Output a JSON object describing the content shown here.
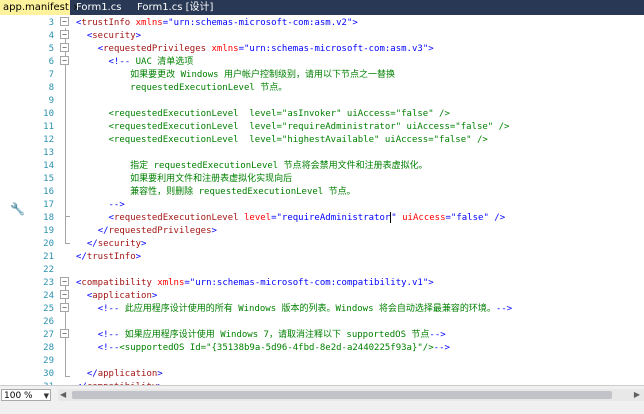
{
  "tabs": [
    {
      "label": "app.manifest",
      "active": true,
      "close": "×"
    },
    {
      "label": "Form1.cs",
      "active": false
    },
    {
      "label": "Form1.cs [设计]",
      "active": false
    }
  ],
  "editor": {
    "lines": [
      {
        "n": "3",
        "segments": [
          [
            "punc",
            "<"
          ],
          [
            "tag",
            "trustInfo"
          ],
          [
            "txt",
            " "
          ],
          [
            "attr",
            "xmlns"
          ],
          [
            "punc",
            "=\""
          ],
          [
            "val",
            "urn:schemas-microsoft-com:asm.v2"
          ],
          [
            "punc",
            "\">"
          ]
        ]
      },
      {
        "n": "4",
        "segments": [
          [
            "txt",
            "  "
          ],
          [
            "punc",
            "<"
          ],
          [
            "tag",
            "security"
          ],
          [
            "punc",
            ">"
          ]
        ]
      },
      {
        "n": "5",
        "segments": [
          [
            "txt",
            "    "
          ],
          [
            "punc",
            "<"
          ],
          [
            "tag",
            "requestedPrivileges"
          ],
          [
            "txt",
            " "
          ],
          [
            "attr",
            "xmlns"
          ],
          [
            "punc",
            "=\""
          ],
          [
            "val",
            "urn:schemas-microsoft-com:asm.v3"
          ],
          [
            "punc",
            "\">"
          ]
        ]
      },
      {
        "n": "6",
        "segments": [
          [
            "txt",
            "      "
          ],
          [
            "punc",
            "<!--"
          ],
          [
            "cmt",
            " UAC 清单选项"
          ]
        ]
      },
      {
        "n": "7",
        "segments": [
          [
            "cmt",
            "          如果要更改 Windows 用户帐户控制级别，请用以下节点之一替换"
          ]
        ]
      },
      {
        "n": "8",
        "segments": [
          [
            "cmt",
            "          requestedExecutionLevel 节点。"
          ]
        ]
      },
      {
        "n": "9",
        "segments": []
      },
      {
        "n": "10",
        "segments": [
          [
            "cmt",
            "      <requestedExecutionLevel  level=\"asInvoker\" uiAccess=\"false\" />"
          ]
        ]
      },
      {
        "n": "11",
        "segments": [
          [
            "cmt",
            "      <requestedExecutionLevel  level=\"requireAdministrator\" uiAccess=\"false\" />"
          ]
        ]
      },
      {
        "n": "12",
        "segments": [
          [
            "cmt",
            "      <requestedExecutionLevel  level=\"highestAvailable\" uiAccess=\"false\" />"
          ]
        ]
      },
      {
        "n": "13",
        "segments": []
      },
      {
        "n": "14",
        "segments": [
          [
            "cmt",
            "          指定 requestedExecutionLevel 节点将会禁用文件和注册表虚拟化。"
          ]
        ]
      },
      {
        "n": "15",
        "segments": [
          [
            "cmt",
            "          如果要利用文件和注册表虚拟化实现向后"
          ]
        ]
      },
      {
        "n": "16",
        "segments": [
          [
            "cmt",
            "          兼容性，则删除 requestedExecutionLevel 节点。"
          ]
        ]
      },
      {
        "n": "17",
        "segments": [
          [
            "cmt",
            "      "
          ],
          [
            "punc",
            "-->"
          ]
        ]
      },
      {
        "n": "18",
        "segments": [
          [
            "txt",
            "      "
          ],
          [
            "punc",
            "<"
          ],
          [
            "tag",
            "requestedExecutionLevel"
          ],
          [
            "txt",
            " "
          ],
          [
            "attr",
            "level"
          ],
          [
            "punc",
            "=\""
          ],
          [
            "val",
            "requireAdministrator"
          ],
          [
            "caret",
            ""
          ],
          [
            "punc",
            "\""
          ],
          [
            "txt",
            " "
          ],
          [
            "attr",
            "uiAccess"
          ],
          [
            "punc",
            "=\""
          ],
          [
            "val",
            "false"
          ],
          [
            "punc",
            "\""
          ],
          [
            "txt",
            " "
          ],
          [
            "punc",
            "/>"
          ]
        ]
      },
      {
        "n": "19",
        "segments": [
          [
            "txt",
            "    "
          ],
          [
            "punc",
            "</"
          ],
          [
            "tag",
            "requestedPrivileges"
          ],
          [
            "punc",
            ">"
          ]
        ]
      },
      {
        "n": "20",
        "segments": [
          [
            "txt",
            "  "
          ],
          [
            "punc",
            "</"
          ],
          [
            "tag",
            "security"
          ],
          [
            "punc",
            ">"
          ]
        ]
      },
      {
        "n": "21",
        "segments": [
          [
            "punc",
            "</"
          ],
          [
            "tag",
            "trustInfo"
          ],
          [
            "punc",
            ">"
          ]
        ]
      },
      {
        "n": "22",
        "segments": []
      },
      {
        "n": "23",
        "segments": [
          [
            "punc",
            "<"
          ],
          [
            "tag",
            "compatibility"
          ],
          [
            "txt",
            " "
          ],
          [
            "attr",
            "xmlns"
          ],
          [
            "punc",
            "=\""
          ],
          [
            "val",
            "urn:schemas-microsoft-com:compatibility.v1"
          ],
          [
            "punc",
            "\">"
          ]
        ]
      },
      {
        "n": "24",
        "segments": [
          [
            "txt",
            "  "
          ],
          [
            "punc",
            "<"
          ],
          [
            "tag",
            "application"
          ],
          [
            "punc",
            ">"
          ]
        ]
      },
      {
        "n": "25",
        "segments": [
          [
            "txt",
            "    "
          ],
          [
            "punc",
            "<!--"
          ],
          [
            "cmt",
            " 此应用程序设计使用的所有 Windows 版本的列表。Windows 将会自动选择最兼容的环境。"
          ],
          [
            "punc",
            "-->"
          ]
        ]
      },
      {
        "n": "26",
        "segments": []
      },
      {
        "n": "27",
        "segments": [
          [
            "txt",
            "    "
          ],
          [
            "punc",
            "<!--"
          ],
          [
            "cmt",
            " 如果应用程序设计使用 Windows 7，请取消注释以下 supportedOS 节点"
          ],
          [
            "punc",
            "-->"
          ]
        ]
      },
      {
        "n": "28",
        "segments": [
          [
            "txt",
            "    "
          ],
          [
            "punc",
            "<!--"
          ],
          [
            "cmt",
            "<supportedOS Id=\"{35138b9a-5d96-4fbd-8e2d-a2440225f93a}\"/>"
          ],
          [
            "punc",
            "-->"
          ]
        ]
      },
      {
        "n": "29",
        "segments": []
      },
      {
        "n": "30",
        "segments": [
          [
            "txt",
            "  "
          ],
          [
            "punc",
            "</"
          ],
          [
            "tag",
            "application"
          ],
          [
            "punc",
            ">"
          ]
        ]
      },
      {
        "n": "31",
        "segments": [
          [
            "punc",
            "</"
          ],
          [
            "tag",
            "compatibility"
          ],
          [
            "punc",
            ">"
          ]
        ]
      },
      {
        "n": "32",
        "segments": []
      },
      {
        "n": "33",
        "segments": []
      }
    ]
  },
  "status": {
    "zoom": "100 %",
    "zoom_arrow": "▼",
    "scroll_left": "◀",
    "scroll_right": "▶"
  },
  "icons": {
    "wrench": "🔧"
  },
  "colors": {
    "tabbar": "#293955",
    "active_tab": "#fff29d",
    "tag": "#a31515",
    "attr": "#ff0000",
    "value": "#0000ff",
    "comment": "#008000",
    "line_number": "#2b91af"
  }
}
